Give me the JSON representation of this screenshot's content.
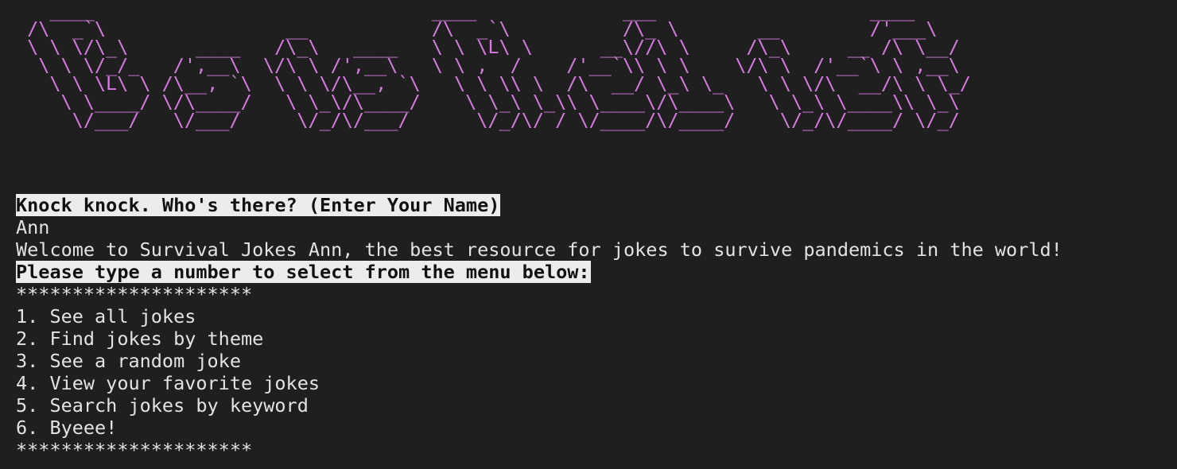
{
  "banner": {
    "ascii_art": "   ____                              ____             ___                   ____\n /\\  _`\\                __           /\\  _`\\          /\\_ \\       __        /'___\\\n \\ \\ \\/\\_\\      ____   /\\_\\   ____   \\ \\ \\L\\ \\      __\\//\\ \\     /\\_\\     __ /\\ \\__/\n  \\ \\ \\/_/_   /',__\\  \\/\\ \\ /',__\\   \\ \\ ,  /    /'__`\\\\ \\ \\    \\/\\ \\  /'__`\\ \\ ,__\\\n   \\ \\ \\L\\ \\ /\\__, `\\  \\ \\ \\/\\__, `\\   \\ \\ \\\\ \\  /\\  __/ \\_\\ \\_   \\ \\ \\/\\  __/\\ \\ \\_/\n    \\ \\____/ \\/\\____/   \\ \\_\\/\\____/    \\ \\_\\ \\_\\\\ \\____\\/\\____\\   \\ \\_\\ \\____\\\\ \\_\\\n     \\/___/   \\/___/     \\/_/\\/___/      \\/_/\\/ / \\/____/\\/____/    \\/_/\\/____/ \\/_/",
    "color": "#d77be3"
  },
  "prompt": {
    "ask_name": "Knock knock. Who's there? (Enter Your Name)",
    "user_input": "Ann",
    "welcome": "Welcome to Survival Jokes Ann, the best resource for jokes to survive pandemics in the world!",
    "menu_instruction": "Please type a number to select from the menu below:"
  },
  "menu": {
    "divider": "*********************",
    "items": [
      "1. See all jokes",
      "2. Find jokes by theme",
      "3. See a random joke",
      "4. View your favorite jokes",
      "5. Search jokes by keyword",
      "6. Byeee!"
    ]
  },
  "colors": {
    "background": "#1f1f1f",
    "text": "#e3e3e3",
    "highlight_bg": "#ececec",
    "highlight_text": "#111111"
  }
}
